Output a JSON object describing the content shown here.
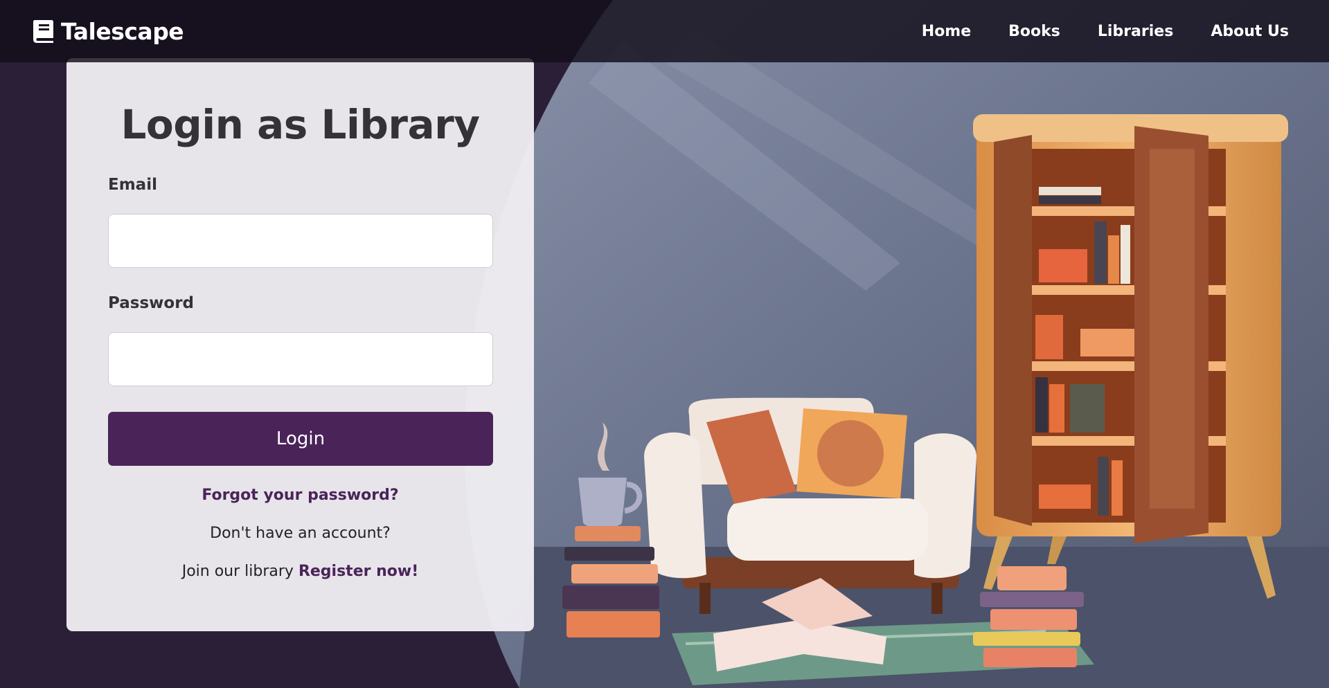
{
  "brand": {
    "name": "Talescape",
    "icon": "book-icon"
  },
  "nav": {
    "items": [
      "Home",
      "Books",
      "Libraries",
      "About Us"
    ]
  },
  "login": {
    "title": "Login as Library",
    "email_label": "Email",
    "email_value": "",
    "password_label": "Password",
    "password_value": "",
    "button_label": "Login",
    "forgot_label": "Forgot your password?",
    "no_account_text": "Don't have an account?",
    "join_text": "Join our library ",
    "register_label": "Register now!"
  },
  "colors": {
    "accent": "#4a2459",
    "page_bg": "#2b1f38",
    "navbar_bg": "#15111c",
    "card_bg": "#efedf1"
  }
}
